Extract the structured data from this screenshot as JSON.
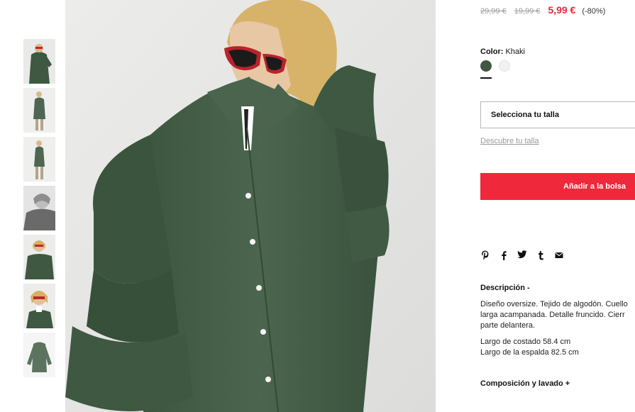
{
  "thumbnails": [
    {
      "alt": "thumbnail-1"
    },
    {
      "alt": "thumbnail-2"
    },
    {
      "alt": "thumbnail-3"
    },
    {
      "alt": "thumbnail-4"
    },
    {
      "alt": "thumbnail-5"
    },
    {
      "alt": "thumbnail-6"
    },
    {
      "alt": "thumbnail-7"
    }
  ],
  "price": {
    "original": "29,99 €",
    "previous": "19,99 €",
    "current": "5,99 €",
    "discount": "(-80%)"
  },
  "color": {
    "label": "Color:",
    "value": "Khaki",
    "swatches": [
      {
        "name": "Khaki",
        "hex": "#3f5841"
      },
      {
        "name": "White",
        "hex": "#f1f1f1"
      }
    ]
  },
  "size": {
    "select_label": "Selecciona tu talla",
    "guide_link": "Descubre tu talla"
  },
  "actions": {
    "add_to_bag": "Añadir a la bolsa"
  },
  "share": [
    {
      "icon": "pinterest-icon",
      "glyph": "𝓅"
    },
    {
      "icon": "facebook-icon",
      "glyph": "f"
    },
    {
      "icon": "twitter-icon",
      "glyph": "🐦"
    },
    {
      "icon": "tumblr-icon",
      "glyph": "t"
    },
    {
      "icon": "email-icon",
      "glyph": "✉"
    }
  ],
  "description": {
    "title": "Descripción -",
    "lines": [
      "Diseño oversize. Tejido de algodón. Cuello",
      "larga acampanada. Detalle fruncido. Cierr",
      "parte delantera."
    ],
    "measures": [
      "Largo de costado 58.4 cm",
      "Largo de la espalda 82.5 cm"
    ]
  },
  "composition": {
    "title": "Composición y lavado +"
  },
  "colors": {
    "accent": "#f0283b",
    "sale_price": "#e3283c",
    "garment": "#46604a"
  }
}
